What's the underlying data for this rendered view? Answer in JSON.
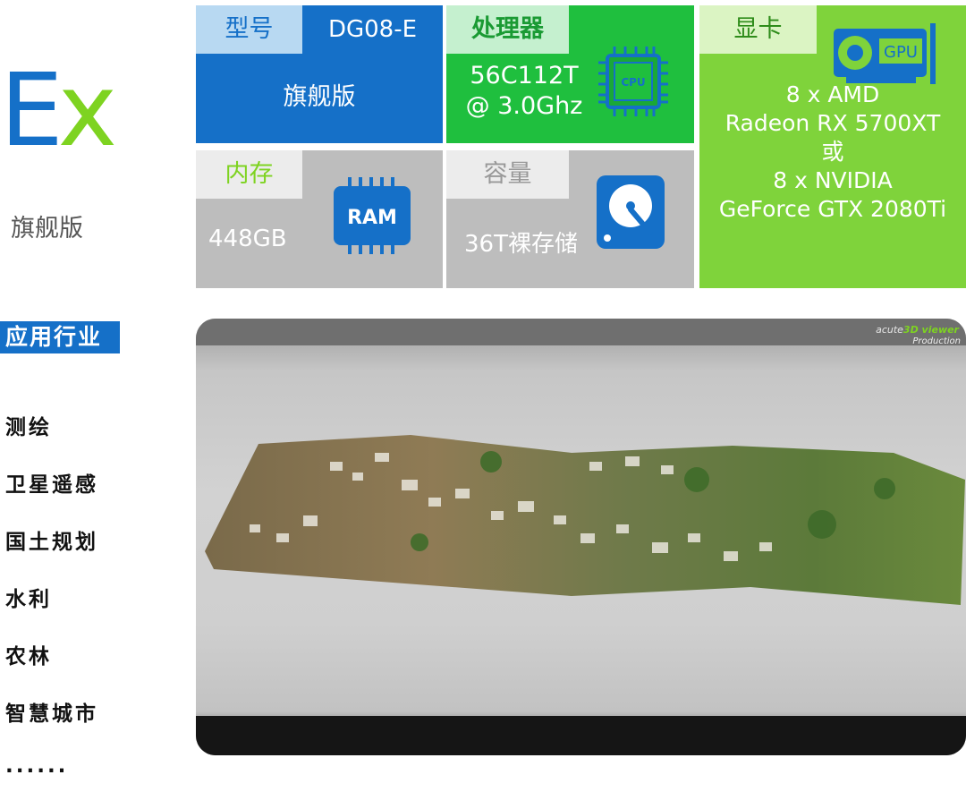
{
  "left": {
    "brand_e": "E",
    "brand_x": "x",
    "edition": "旗舰版",
    "industry_title": "应用行业",
    "industries": [
      "测绘",
      "卫星遥感",
      "国土规划",
      "水利",
      "农林",
      "智慧城市",
      "······"
    ]
  },
  "specs": {
    "model": {
      "label": "型号",
      "code": "DG08-E",
      "value": "旗舰版"
    },
    "cpu": {
      "label": "处理器",
      "value_line1": "56C112T",
      "value_line2": "@ 3.0Ghz",
      "icon_text": "CPU"
    },
    "gpu": {
      "label": "显卡",
      "icon_text": "GPU",
      "lines": [
        "8 x AMD",
        "Radeon RX 5700XT",
        "或",
        "8 x NVIDIA",
        "GeForce GTX 2080Ti"
      ]
    },
    "memory": {
      "label": "内存",
      "value": "448GB",
      "icon_text": "RAM"
    },
    "storage": {
      "label": "容量",
      "value": "36T裸存储"
    }
  },
  "photo": {
    "viewer_brand": "acute",
    "viewer_brand_highlight": "3D viewer",
    "viewer_tag": "Production"
  },
  "colors": {
    "blue": "#1570c8",
    "green": "#1fbf3e",
    "lime": "#7fd33b",
    "gray": "#bdbdbd"
  }
}
